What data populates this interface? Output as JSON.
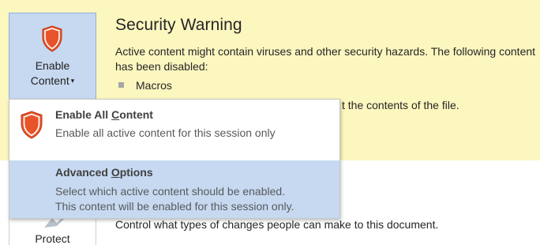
{
  "warning": {
    "title": "Security Warning",
    "description": "Active content might contain viruses and other security hazards. The following content has been disabled:",
    "disabled_items": [
      "Macros"
    ],
    "partial_text": "t the contents of the file."
  },
  "enable_button": {
    "line1": "Enable",
    "line2": "Content",
    "caret": "▾"
  },
  "menu": {
    "items": [
      {
        "title_pre": "Enable All ",
        "title_accel": "C",
        "title_post": "ontent",
        "description": "Enable all active content for this session only"
      },
      {
        "title_pre": "Advanced ",
        "title_accel": "O",
        "title_post": "ptions",
        "description_line1": "Select which active content should be enabled.",
        "description_line2": "This content will be enabled for this session only."
      }
    ]
  },
  "protect": {
    "label": "Protect",
    "description": "Control what types of changes people can make to this document."
  },
  "colors": {
    "warning_bg": "#fcf6bf",
    "button_bg": "#c7d9f0",
    "shield_orange": "#e8542a",
    "highlight": "#c6d9f1"
  },
  "icons": {
    "enable_button_icon": "shield-icon",
    "menu_item_icon": "shield-icon",
    "protect_icon": "protect-document-icon"
  }
}
